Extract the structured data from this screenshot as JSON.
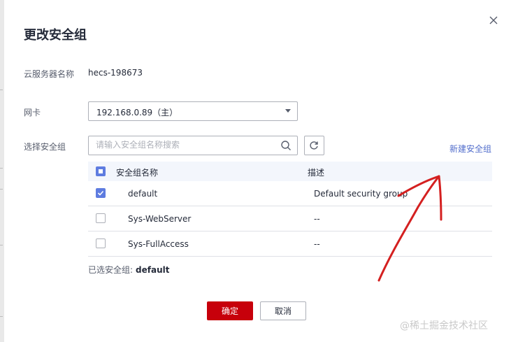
{
  "dialog": {
    "title": "更改安全组",
    "close_icon": "close-icon"
  },
  "form": {
    "server_name_label": "云服务器名称",
    "server_name_value": "hecs-198673",
    "nic_label": "网卡",
    "nic_value": "192.168.0.89（主）",
    "sg_label": "选择安全组",
    "search_placeholder": "请输入安全组名称搜索",
    "new_sg_link": "新建安全组"
  },
  "table": {
    "columns": [
      "安全组名称",
      "描述"
    ],
    "rows": [
      {
        "name": "default",
        "description": "Default security group",
        "checked": true
      },
      {
        "name": "Sys-WebServer",
        "description": "--",
        "checked": false
      },
      {
        "name": "Sys-FullAccess",
        "description": "--",
        "checked": false
      }
    ]
  },
  "selected": {
    "label": "已选安全组:",
    "value": "default"
  },
  "footer": {
    "ok_label": "确定",
    "cancel_label": "取消"
  },
  "watermark": "@稀土掘金技术社区",
  "colors": {
    "primary": "#c7000b",
    "accent": "#5e7ce0",
    "link": "#526ecc",
    "annotation": "#d42020"
  }
}
